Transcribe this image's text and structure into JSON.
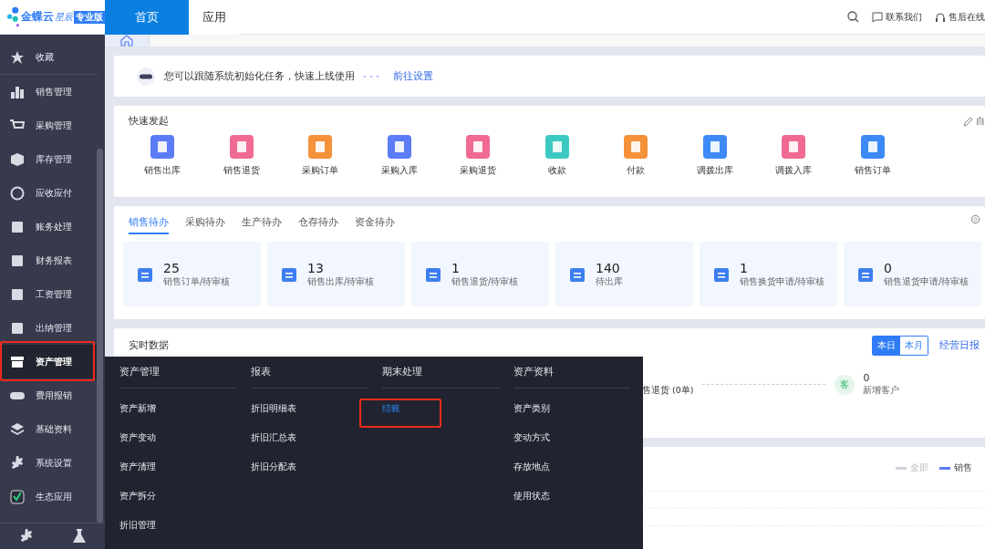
{
  "header": {
    "brand": "金蝶云",
    "product": "星辰",
    "edition": "专业版",
    "tabs": [
      {
        "label": "首页",
        "selected": true
      },
      {
        "label": "应用",
        "selected": false
      }
    ],
    "links": [
      "联系我们",
      "售后在线"
    ]
  },
  "sidebar": {
    "items": [
      {
        "label": "收藏",
        "selected": false
      },
      {
        "label": "销售管理",
        "selected": false
      },
      {
        "label": "采购管理",
        "selected": false
      },
      {
        "label": "库存管理",
        "selected": false
      },
      {
        "label": "应收应付",
        "selected": false
      },
      {
        "label": "账务处理",
        "selected": false
      },
      {
        "label": "财务报表",
        "selected": false
      },
      {
        "label": "工资管理",
        "selected": false
      },
      {
        "label": "出纳管理",
        "selected": false
      },
      {
        "label": "资产管理",
        "selected": true
      },
      {
        "label": "费用报销",
        "selected": false
      },
      {
        "label": "基础资料",
        "selected": false
      },
      {
        "label": "系统设置",
        "selected": false
      },
      {
        "label": "生态应用",
        "selected": false
      }
    ]
  },
  "notice": {
    "text": "您可以跟随系统初始化任务，快速上线使用",
    "link": "前往设置"
  },
  "quick_start": {
    "title": "快速发起",
    "customize": "自",
    "items": [
      {
        "label": "销售出库",
        "color": "#5b7cf5"
      },
      {
        "label": "销售退货",
        "color": "#f06a92"
      },
      {
        "label": "采购订单",
        "color": "#f5913a"
      },
      {
        "label": "采购入库",
        "color": "#5b7cf5"
      },
      {
        "label": "采购退货",
        "color": "#f06a92"
      },
      {
        "label": "收款",
        "color": "#3cc9c4"
      },
      {
        "label": "付款",
        "color": "#f5913a"
      },
      {
        "label": "调拨出库",
        "color": "#3d8af7"
      },
      {
        "label": "调拨入库",
        "color": "#f06a92"
      },
      {
        "label": "销售订单",
        "color": "#3d8af7"
      }
    ]
  },
  "todo": {
    "tabs": [
      {
        "label": "销售待办",
        "selected": true
      },
      {
        "label": "采购待办",
        "selected": false
      },
      {
        "label": "生产待办",
        "selected": false
      },
      {
        "label": "仓存待办",
        "selected": false
      },
      {
        "label": "资金待办",
        "selected": false
      }
    ],
    "tiles": [
      {
        "count": "25",
        "label": "销售订单/待审核"
      },
      {
        "count": "13",
        "label": "销售出库/待审核"
      },
      {
        "count": "1",
        "label": "销售退货/待审核"
      },
      {
        "count": "140",
        "label": "待出库"
      },
      {
        "count": "1",
        "label": "销售换货申请/待审核"
      },
      {
        "count": "0",
        "label": "销售退货申请/待审核"
      }
    ]
  },
  "realtime": {
    "title": "实时数据",
    "periods": [
      {
        "label": "本日",
        "selected": true
      },
      {
        "label": "本月",
        "selected": false
      }
    ],
    "report_link": "经营日报",
    "partial_label": "售退货 (0单)",
    "customer": {
      "badge": "客",
      "count": "0",
      "label": "新增客户"
    }
  },
  "chart_legend": [
    {
      "label": "全部",
      "color": "#cfd3da"
    },
    {
      "label": "销售",
      "color": "#5b7cf5"
    }
  ],
  "flyout": {
    "columns": [
      {
        "title": "资产管理",
        "items": [
          {
            "label": "资产新增",
            "selected": false
          },
          {
            "label": "资产变动",
            "selected": false
          },
          {
            "label": "资产清理",
            "selected": false
          },
          {
            "label": "资产拆分",
            "selected": false
          },
          {
            "label": "折旧管理",
            "selected": false
          }
        ]
      },
      {
        "title": "报表",
        "items": [
          {
            "label": "折旧明细表",
            "selected": false
          },
          {
            "label": "折旧汇总表",
            "selected": false
          },
          {
            "label": "折旧分配表",
            "selected": false
          }
        ]
      },
      {
        "title": "期末处理",
        "items": [
          {
            "label": "结账",
            "selected": true
          }
        ]
      },
      {
        "title": "资产资料",
        "items": [
          {
            "label": "资产类别",
            "selected": false
          },
          {
            "label": "变动方式",
            "selected": false
          },
          {
            "label": "存放地点",
            "selected": false
          },
          {
            "label": "使用状态",
            "selected": false
          }
        ]
      }
    ]
  }
}
